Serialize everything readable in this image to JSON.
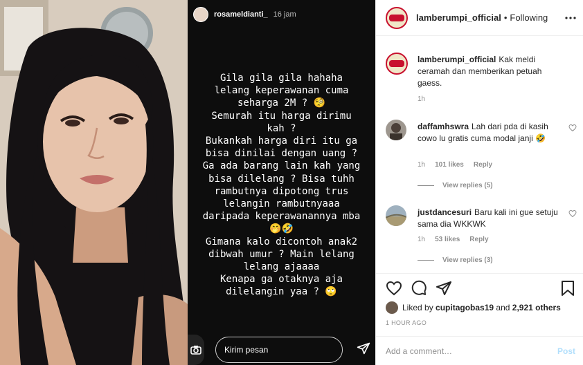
{
  "story": {
    "username": "rosameldianti_",
    "time": "16 jam",
    "lines": [
      "Gila gila gila hahaha",
      "lelang keperawanan cuma",
      "seharga 2M ? 🧐",
      "Semurah itu harga dirimu",
      "kah ?",
      "Bukankah harga diri itu ga",
      "bisa dinilai dengan uang ?",
      "Ga ada barang lain kah yang",
      "bisa dilelang ? Bisa tuhh",
      "rambutnya dipotong trus",
      "lelangin rambutnyaaa",
      "daripada keperawanannya mba",
      "🤭🤣",
      "Gimana kalo dicontoh anak2",
      "dibwah umur ? Main lelang",
      "lelang ajaaaa",
      "Kenapa ga otaknya aja",
      "dilelangin yaa ? 🙄"
    ],
    "reply_placeholder": "Kirim pesan"
  },
  "post": {
    "account": "lamberumpi_official",
    "separator": "•",
    "follow_state": "Following",
    "caption": {
      "username": "lamberumpi_official",
      "text": "Kak meldi ceramah dan memberikan petuah gaess.",
      "time": "1h"
    },
    "comments": [
      {
        "username": "daffamhswra",
        "text": "Lah dari pda di kasih cowo lu gratis cuma modal janji 🤣",
        "time": "1h",
        "likes": "101 likes",
        "reply": "Reply",
        "view_replies": "View replies (5)"
      },
      {
        "username": "justdancesuri",
        "text": "Baru kali ini gue setuju sama dia WKKWK",
        "time": "1h",
        "likes": "53 likes",
        "reply": "Reply",
        "view_replies": "View replies (3)"
      }
    ],
    "liked_by_prefix": "Liked by",
    "liked_by_user": "cupitagobas19",
    "liked_by_and": "and",
    "liked_by_others": "2,921 others",
    "time_ago": "1 HOUR AGO",
    "add_comment_placeholder": "Add a comment…",
    "post_button": "Post"
  },
  "icons": {
    "heart": "heart-icon",
    "comment": "comment-icon",
    "share": "share-icon",
    "save": "bookmark-icon",
    "more": "more-icon",
    "camera": "camera-icon",
    "send": "send-icon"
  },
  "colors": {
    "story_bg": "#0d0d0d",
    "accent_red": "#c8102e",
    "post_button_disabled": "#b2dffc",
    "muted": "#8e8e8e"
  }
}
